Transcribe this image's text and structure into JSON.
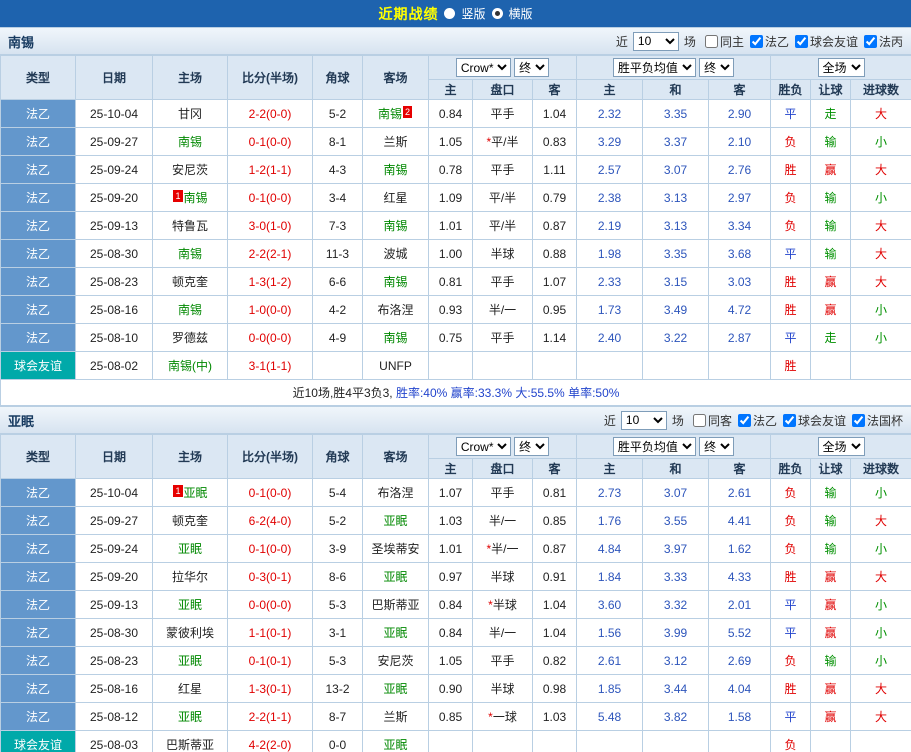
{
  "topbar": {
    "title": "近期战绩",
    "vertical_label": "竖版",
    "horizontal_label": "横版",
    "selected": "横版"
  },
  "headers": {
    "type": "类型",
    "date": "日期",
    "home": "主场",
    "score": "比分(半场)",
    "corner": "角球",
    "away": "客场",
    "asian_home": "主",
    "handicap": "盘口",
    "asian_away": "客",
    "euro_home": "主",
    "euro_draw": "和",
    "euro_away": "客",
    "result": "胜负",
    "handicap_result": "让球",
    "goals": "进球数"
  },
  "colors": {
    "accent_blue": "#1e63ae",
    "type_blue": "#6397cc",
    "type_teal": "#00a9a9",
    "win_loss_red": "#e00000",
    "green": "#009000",
    "draw_blue": "#2244cc",
    "self_team_green": "#008800"
  },
  "sections": [
    {
      "team": "南锡",
      "near_label": "近",
      "count": "10",
      "games_label": "场",
      "filters": [
        {
          "label": "同主",
          "checked": false
        },
        {
          "label": "法乙",
          "checked": true
        },
        {
          "label": "球会友谊",
          "checked": true
        },
        {
          "label": "法丙",
          "checked": true
        }
      ],
      "selects": {
        "company": "Crow*",
        "final1": "终",
        "europe": "胜平负均值",
        "final2": "终",
        "scope": "全场"
      },
      "rows": [
        {
          "type": "法乙",
          "date": "25-10-04",
          "home": {
            "t": "甘冈"
          },
          "score": "2-2(0-0)",
          "corner": "5-2",
          "away": {
            "t": "南锡",
            "me": 1,
            "badge": "2",
            "bpos": "after"
          },
          "o1": "0.84",
          "star": false,
          "pk": "平手",
          "o2": "1.04",
          "e1": "2.32",
          "e2": "3.35",
          "e3": "2.90",
          "r1": "平",
          "r2": "走",
          "r3": "大"
        },
        {
          "type": "法乙",
          "date": "25-09-27",
          "home": {
            "t": "南锡",
            "me": 1
          },
          "score": "0-1(0-0)",
          "corner": "8-1",
          "away": {
            "t": "兰斯"
          },
          "o1": "1.05",
          "star": true,
          "pk": "平/半",
          "o2": "0.83",
          "e1": "3.29",
          "e2": "3.37",
          "e3": "2.10",
          "r1": "负",
          "r2": "输",
          "r3": "小"
        },
        {
          "type": "法乙",
          "date": "25-09-24",
          "home": {
            "t": "安尼茨"
          },
          "score": "1-2(1-1)",
          "corner": "4-3",
          "away": {
            "t": "南锡",
            "me": 1
          },
          "o1": "0.78",
          "star": false,
          "pk": "平手",
          "o2": "1.11",
          "e1": "2.57",
          "e2": "3.07",
          "e3": "2.76",
          "r1": "胜",
          "r2": "赢",
          "r3": "大"
        },
        {
          "type": "法乙",
          "date": "25-09-20",
          "home": {
            "t": "南锡",
            "me": 1,
            "badge": "1",
            "bpos": "before"
          },
          "score": "0-1(0-0)",
          "corner": "3-4",
          "away": {
            "t": "红星"
          },
          "o1": "1.09",
          "star": false,
          "pk": "平/半",
          "o2": "0.79",
          "e1": "2.38",
          "e2": "3.13",
          "e3": "2.97",
          "r1": "负",
          "r2": "输",
          "r3": "小"
        },
        {
          "type": "法乙",
          "date": "25-09-13",
          "home": {
            "t": "特鲁瓦"
          },
          "score": "3-0(1-0)",
          "corner": "7-3",
          "away": {
            "t": "南锡",
            "me": 1
          },
          "o1": "1.01",
          "star": false,
          "pk": "平/半",
          "o2": "0.87",
          "e1": "2.19",
          "e2": "3.13",
          "e3": "3.34",
          "r1": "负",
          "r2": "输",
          "r3": "大"
        },
        {
          "type": "法乙",
          "date": "25-08-30",
          "home": {
            "t": "南锡",
            "me": 1
          },
          "score": "2-2(2-1)",
          "corner": "11-3",
          "away": {
            "t": "波城"
          },
          "o1": "1.00",
          "star": false,
          "pk": "半球",
          "o2": "0.88",
          "e1": "1.98",
          "e2": "3.35",
          "e3": "3.68",
          "r1": "平",
          "r2": "输",
          "r3": "大"
        },
        {
          "type": "法乙",
          "date": "25-08-23",
          "home": {
            "t": "顿克奎"
          },
          "score": "1-3(1-2)",
          "corner": "6-6",
          "away": {
            "t": "南锡",
            "me": 1
          },
          "o1": "0.81",
          "star": false,
          "pk": "平手",
          "o2": "1.07",
          "e1": "2.33",
          "e2": "3.15",
          "e3": "3.03",
          "r1": "胜",
          "r2": "赢",
          "r3": "大"
        },
        {
          "type": "法乙",
          "date": "25-08-16",
          "home": {
            "t": "南锡",
            "me": 1
          },
          "score": "1-0(0-0)",
          "corner": "4-2",
          "away": {
            "t": "布洛涅"
          },
          "o1": "0.93",
          "star": false,
          "pk": "半/一",
          "o2": "0.95",
          "e1": "1.73",
          "e2": "3.49",
          "e3": "4.72",
          "r1": "胜",
          "r2": "赢",
          "r3": "小"
        },
        {
          "type": "法乙",
          "date": "25-08-10",
          "home": {
            "t": "罗德兹"
          },
          "score": "0-0(0-0)",
          "corner": "4-9",
          "away": {
            "t": "南锡",
            "me": 1
          },
          "o1": "0.75",
          "star": false,
          "pk": "平手",
          "o2": "1.14",
          "e1": "2.40",
          "e2": "3.22",
          "e3": "2.87",
          "r1": "平",
          "r2": "走",
          "r3": "小"
        },
        {
          "type": "球会友谊",
          "date": "25-08-02",
          "home": {
            "t": "南锡(中)",
            "me": 1
          },
          "score": "3-1(1-1)",
          "corner": "",
          "away": {
            "t": "UNFP"
          },
          "o1": "",
          "star": false,
          "pk": "",
          "o2": "",
          "e1": "",
          "e2": "",
          "e3": "",
          "r1": "胜",
          "r2": "",
          "r3": ""
        }
      ],
      "summary": [
        {
          "t": "近10场,胜4平3负3, "
        },
        {
          "t": "胜率:40% ",
          "c": "blue"
        },
        {
          "t": "赢率:33.3% ",
          "c": "blue"
        },
        {
          "t": "大:55.5% ",
          "c": "blue"
        },
        {
          "t": "单率:50%",
          "c": "blue"
        }
      ]
    },
    {
      "team": "亚眠",
      "near_label": "近",
      "count": "10",
      "games_label": "场",
      "filters": [
        {
          "label": "同客",
          "checked": false
        },
        {
          "label": "法乙",
          "checked": true
        },
        {
          "label": "球会友谊",
          "checked": true
        },
        {
          "label": "法国杯",
          "checked": true
        }
      ],
      "selects": {
        "company": "Crow*",
        "final1": "终",
        "europe": "胜平负均值",
        "final2": "终",
        "scope": "全场"
      },
      "rows": [
        {
          "type": "法乙",
          "date": "25-10-04",
          "home": {
            "t": "亚眠",
            "me": 1,
            "badge": "1",
            "bpos": "before"
          },
          "score": "0-1(0-0)",
          "corner": "5-4",
          "away": {
            "t": "布洛涅"
          },
          "o1": "1.07",
          "star": false,
          "pk": "平手",
          "o2": "0.81",
          "e1": "2.73",
          "e2": "3.07",
          "e3": "2.61",
          "r1": "负",
          "r2": "输",
          "r3": "小"
        },
        {
          "type": "法乙",
          "date": "25-09-27",
          "home": {
            "t": "顿克奎"
          },
          "score": "6-2(4-0)",
          "corner": "5-2",
          "away": {
            "t": "亚眠",
            "me": 1
          },
          "o1": "1.03",
          "star": false,
          "pk": "半/一",
          "o2": "0.85",
          "e1": "1.76",
          "e2": "3.55",
          "e3": "4.41",
          "r1": "负",
          "r2": "输",
          "r3": "大"
        },
        {
          "type": "法乙",
          "date": "25-09-24",
          "home": {
            "t": "亚眠",
            "me": 1
          },
          "score": "0-1(0-0)",
          "corner": "3-9",
          "away": {
            "t": "圣埃蒂安"
          },
          "o1": "1.01",
          "star": true,
          "pk": "半/一",
          "o2": "0.87",
          "e1": "4.84",
          "e2": "3.97",
          "e3": "1.62",
          "r1": "负",
          "r2": "输",
          "r3": "小"
        },
        {
          "type": "法乙",
          "date": "25-09-20",
          "home": {
            "t": "拉华尔"
          },
          "score": "0-3(0-1)",
          "corner": "8-6",
          "away": {
            "t": "亚眠",
            "me": 1
          },
          "o1": "0.97",
          "star": false,
          "pk": "半球",
          "o2": "0.91",
          "e1": "1.84",
          "e2": "3.33",
          "e3": "4.33",
          "r1": "胜",
          "r2": "赢",
          "r3": "大"
        },
        {
          "type": "法乙",
          "date": "25-09-13",
          "home": {
            "t": "亚眠",
            "me": 1
          },
          "score": "0-0(0-0)",
          "corner": "5-3",
          "away": {
            "t": "巴斯蒂亚"
          },
          "o1": "0.84",
          "star": true,
          "pk": "半球",
          "o2": "1.04",
          "e1": "3.60",
          "e2": "3.32",
          "e3": "2.01",
          "r1": "平",
          "r2": "赢",
          "r3": "小"
        },
        {
          "type": "法乙",
          "date": "25-08-30",
          "home": {
            "t": "蒙彼利埃"
          },
          "score": "1-1(0-1)",
          "corner": "3-1",
          "away": {
            "t": "亚眠",
            "me": 1
          },
          "o1": "0.84",
          "star": false,
          "pk": "半/一",
          "o2": "1.04",
          "e1": "1.56",
          "e2": "3.99",
          "e3": "5.52",
          "r1": "平",
          "r2": "赢",
          "r3": "小"
        },
        {
          "type": "法乙",
          "date": "25-08-23",
          "home": {
            "t": "亚眠",
            "me": 1
          },
          "score": "0-1(0-1)",
          "corner": "5-3",
          "away": {
            "t": "安尼茨"
          },
          "o1": "1.05",
          "star": false,
          "pk": "平手",
          "o2": "0.82",
          "e1": "2.61",
          "e2": "3.12",
          "e3": "2.69",
          "r1": "负",
          "r2": "输",
          "r3": "小"
        },
        {
          "type": "法乙",
          "date": "25-08-16",
          "home": {
            "t": "红星"
          },
          "score": "1-3(0-1)",
          "corner": "13-2",
          "away": {
            "t": "亚眠",
            "me": 1
          },
          "o1": "0.90",
          "star": false,
          "pk": "半球",
          "o2": "0.98",
          "e1": "1.85",
          "e2": "3.44",
          "e3": "4.04",
          "r1": "胜",
          "r2": "赢",
          "r3": "大"
        },
        {
          "type": "法乙",
          "date": "25-08-12",
          "home": {
            "t": "亚眠",
            "me": 1
          },
          "score": "2-2(1-1)",
          "corner": "8-7",
          "away": {
            "t": "兰斯"
          },
          "o1": "0.85",
          "star": true,
          "pk": "一球",
          "o2": "1.03",
          "e1": "5.48",
          "e2": "3.82",
          "e3": "1.58",
          "r1": "平",
          "r2": "赢",
          "r3": "大"
        },
        {
          "type": "球会友谊",
          "date": "25-08-03",
          "home": {
            "t": "巴斯蒂亚"
          },
          "score": "4-2(2-0)",
          "corner": "0-0",
          "away": {
            "t": "亚眠",
            "me": 1
          },
          "o1": "",
          "star": false,
          "pk": "",
          "o2": "",
          "e1": "",
          "e2": "",
          "e3": "",
          "r1": "负",
          "r2": "",
          "r3": ""
        }
      ],
      "summary": []
    }
  ]
}
